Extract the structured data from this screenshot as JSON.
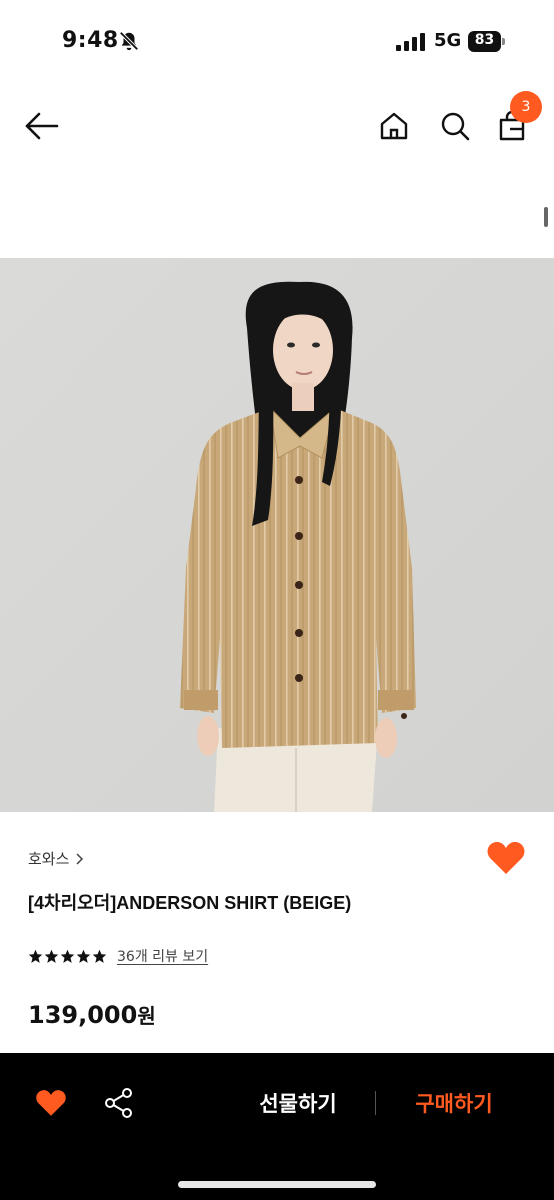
{
  "status_bar": {
    "time": "9:48",
    "network": "5G",
    "battery": "83"
  },
  "nav": {
    "cart_count": "3",
    "icons": [
      "arrow-left-icon",
      "home-icon",
      "search-icon",
      "shopping-bag-icon"
    ]
  },
  "product": {
    "brand": "호와스",
    "title": "[4차리오더]ANDERSON SHIRT (BEIGE)",
    "rating": 5,
    "review_link": "36개 리뷰 보기",
    "price": "139,000",
    "price_unit": "원"
  },
  "actions": {
    "gift_label": "선물하기",
    "buy_label": "구매하기"
  },
  "colors": {
    "accent": "#ff5a1f",
    "background_dark": "#000000",
    "shirt": "#c7a677",
    "wall": "#d7d7d5"
  }
}
